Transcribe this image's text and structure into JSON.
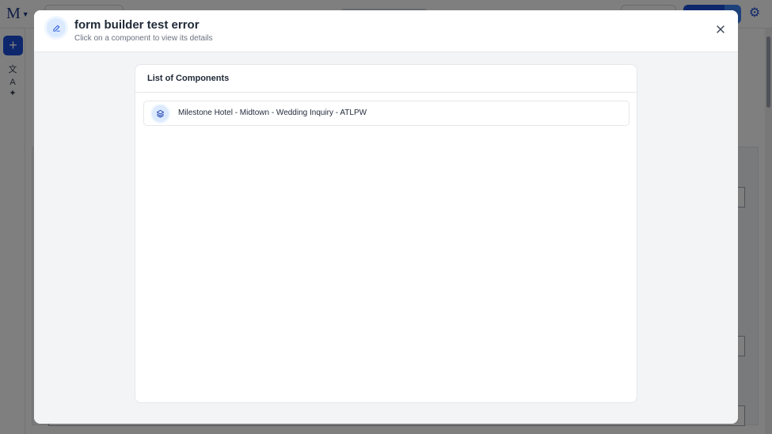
{
  "app": {
    "logo_text": "M"
  },
  "modal": {
    "title": "form builder test error",
    "subtitle": "Click on a component to view its details",
    "header_icon": "pencil-icon",
    "close_icon": "close-icon"
  },
  "card": {
    "title": "List of Components",
    "items": [
      {
        "label": "Milestone Hotel - Midtown - Wedding Inquiry - ATLPW",
        "icon": "layers-icon"
      }
    ]
  },
  "colors": {
    "accent": "#1d4ed8",
    "icon_bg": "#dbeafe",
    "body_bg": "#f3f4f6"
  }
}
